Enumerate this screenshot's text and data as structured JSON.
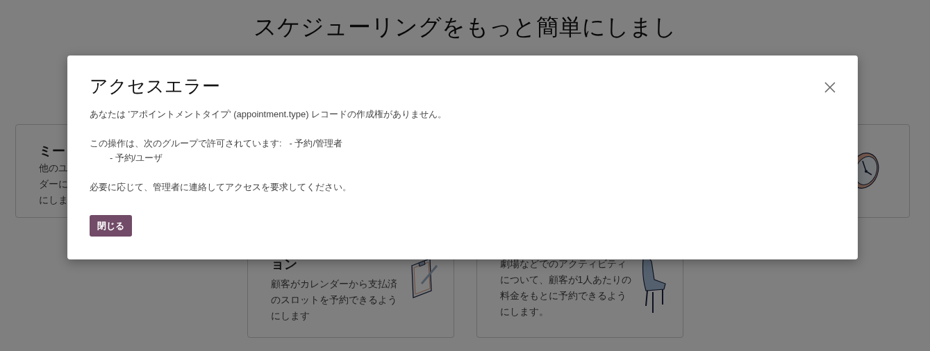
{
  "page": {
    "heading": "スケジューリングをもっと簡単にしまし",
    "top_cards": [
      {
        "title": "ミー",
        "description_lines": [
          "他のユ",
          "ダーに",
          "にしま"
        ]
      }
    ],
    "bottom_cards": [
      {
        "title": "ョン",
        "description": "顧客がカレンダーから支払済のスロットを予約できるようにします"
      },
      {
        "description": "劇場などでのアクティビティについて、顧客が1人あたりの料金をもとに予約できるようにします。"
      }
    ]
  },
  "dialog": {
    "title": "アクセスエラー",
    "message": [
      "あなたは 'アポイントメントタイプ' (appointment.type) レコードの作成権がありません。",
      "この操作は、次のグループで許可されています:   - 予約/管理者\n        - 予約/ユーザ",
      "必要に応じて、管理者に連絡してアクセスを要求してください。"
    ],
    "buttons": [
      "閉じる"
    ]
  }
}
